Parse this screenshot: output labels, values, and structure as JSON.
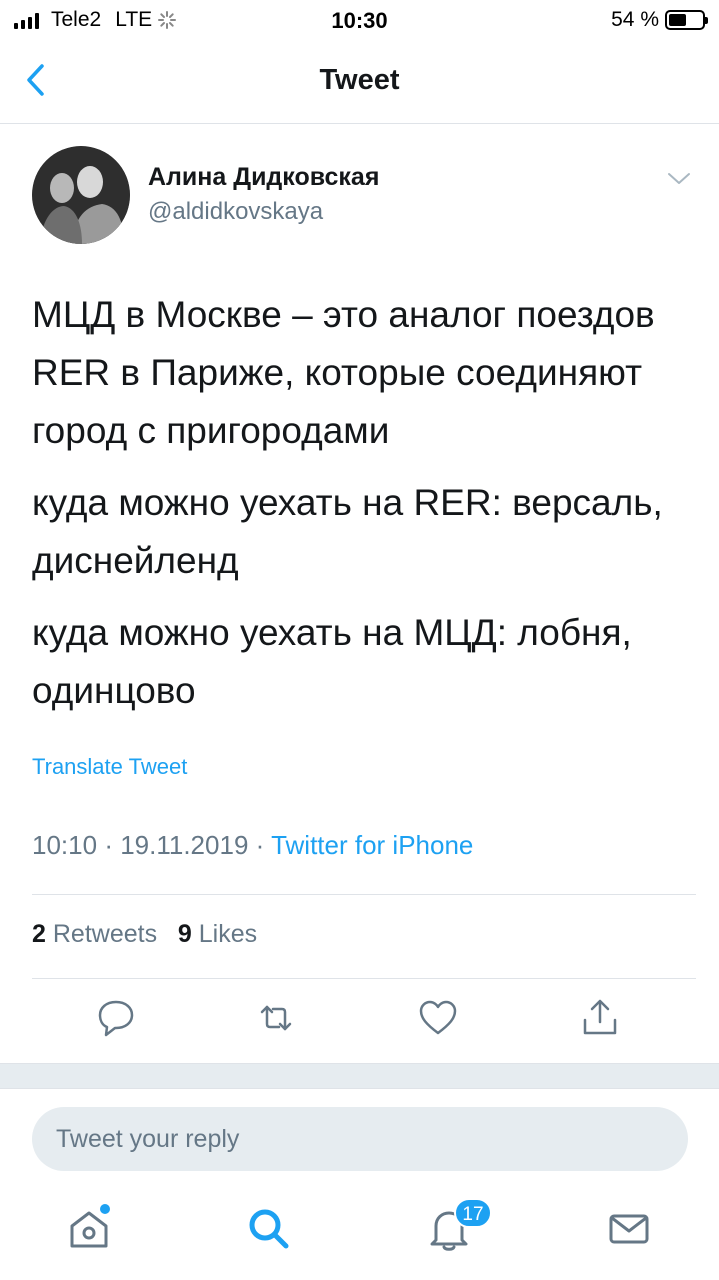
{
  "status_bar": {
    "carrier": "Tele2",
    "network": "LTE",
    "time": "10:30",
    "battery": "54 %",
    "battery_level": 0.54
  },
  "nav": {
    "title": "Tweet",
    "back_icon": "chevron-left-icon"
  },
  "tweet": {
    "author_name": "Алина Дидковская",
    "author_handle": "@aldidkovskaya",
    "paragraphs": [
      "МЦД в Москве – это аналог поездов RER в Париже, которые соединяют город с пригородами",
      "куда можно уехать на RER: версаль, диснейленд",
      "куда можно уехать на МЦД: лобня, одинцово"
    ],
    "translate_label": "Translate Tweet",
    "time": "10:10",
    "date": "19.11.2019",
    "source": "Twitter for iPhone",
    "retweets_count": "2",
    "retweets_label": "Retweets",
    "likes_count": "9",
    "likes_label": "Likes"
  },
  "reply": {
    "placeholder": "Tweet your reply"
  },
  "tabbar": {
    "notifications_badge": "17"
  },
  "colors": {
    "accent": "#1da1f2",
    "secondary_text": "#657786",
    "divider": "#dfe3e8"
  }
}
